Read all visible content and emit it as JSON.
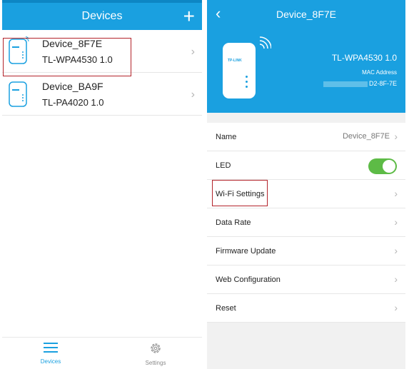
{
  "left": {
    "header": {
      "title": "Devices",
      "add_icon": "plus-icon",
      "add_glyph": "+"
    },
    "devices": [
      {
        "name": "Device_8F7E",
        "model": "TL-WPA4530 1.0",
        "has_wifi": true
      },
      {
        "name": "Device_BA9F",
        "model": "TL-PA4020 1.0",
        "has_wifi": false
      }
    ],
    "tabs": [
      {
        "label": "Devices",
        "icon": "menu-icon"
      },
      {
        "label": "Settings",
        "icon": "gear-icon"
      }
    ]
  },
  "right": {
    "header": {
      "title": "Device_8F7E",
      "back_icon": "chevron-left-icon"
    },
    "device": {
      "brand": "TP-LINK",
      "model": "TL-WPA4530 1.0",
      "mac_label": "MAC Address",
      "mac_visible": "D2-8F-7E"
    },
    "items": [
      {
        "label": "Name",
        "value": "Device_8F7E",
        "chevron": "›"
      },
      {
        "label": "LED",
        "toggle_on": true
      },
      {
        "label": "Wi-Fi Settings",
        "chevron": "›"
      },
      {
        "label": "Data Rate",
        "chevron": "›"
      },
      {
        "label": "Firmware Update",
        "chevron": "›"
      },
      {
        "label": "Web Configuration",
        "chevron": "›"
      },
      {
        "label": "Reset",
        "chevron": "›"
      }
    ]
  },
  "colors": {
    "accent": "#1aa0e0",
    "toggle_on": "#5dbb46",
    "highlight": "#b3232a"
  }
}
